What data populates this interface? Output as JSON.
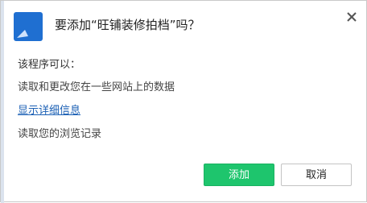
{
  "dialog": {
    "title": "要添加“旺铺装修拍档”吗？",
    "close_icon": "close-icon",
    "app_icon": "wangpu-app-icon"
  },
  "permissions": {
    "heading": "该程序可以：",
    "items": [
      "读取和更改您在一些网站上的数据",
      "读取您的浏览记录"
    ],
    "details_link": "显示详细信息"
  },
  "buttons": {
    "add_label": "添加",
    "cancel_label": "取消"
  },
  "colors": {
    "add_button_bg": "#1ec56d",
    "link": "#1a5fb4",
    "logo_blue": "#1f6fd1"
  }
}
